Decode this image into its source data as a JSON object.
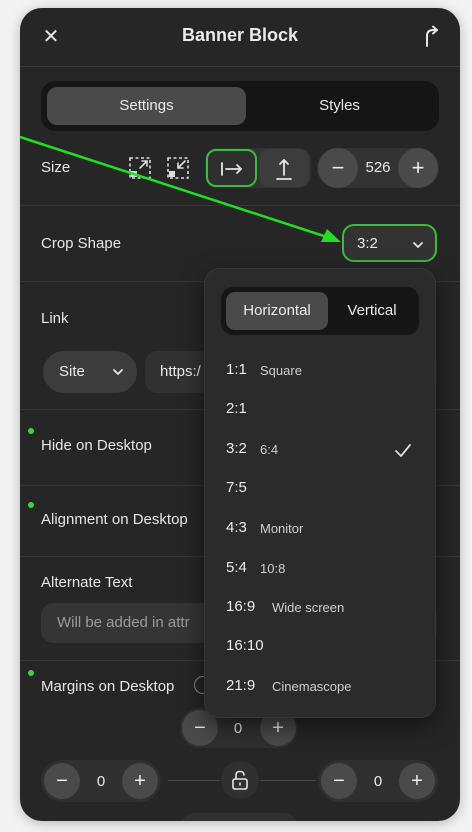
{
  "header": {
    "close_glyph": "✕",
    "title": "Banner Block"
  },
  "tabs": [
    {
      "label": "Settings",
      "active": true
    },
    {
      "label": "Styles",
      "active": false
    }
  ],
  "size": {
    "label": "Size",
    "minus": "−",
    "plus": "+",
    "value": "526"
  },
  "crop": {
    "label": "Crop Shape",
    "value": "3:2"
  },
  "link": {
    "label": "Link",
    "type_value": "Site",
    "url_value": "https:/"
  },
  "hide_desktop": {
    "label": "Hide on Desktop"
  },
  "alignment": {
    "label": "Alignment on Desktop"
  },
  "alt_text": {
    "label": "Alternate Text",
    "placeholder": "Will be added in attr"
  },
  "margins": {
    "label": "Margins on Desktop",
    "top_value": "0",
    "left_value": "0",
    "right_value": "0",
    "minus": "−",
    "plus": "+"
  },
  "dropdown": {
    "tabs": [
      {
        "label": "Horizontal",
        "active": true
      },
      {
        "label": "Vertical",
        "active": false
      }
    ],
    "items": [
      {
        "ratio": "1:1",
        "desc": "Square",
        "selected": false
      },
      {
        "ratio": "2:1",
        "desc": "",
        "selected": false
      },
      {
        "ratio": "3:2",
        "desc": "6:4",
        "selected": true
      },
      {
        "ratio": "7:5",
        "desc": "",
        "selected": false
      },
      {
        "ratio": "4:3",
        "desc": "Monitor",
        "selected": false
      },
      {
        "ratio": "5:4",
        "desc": "10:8",
        "selected": false
      },
      {
        "ratio": "16:9",
        "desc": "Wide screen",
        "selected": false
      },
      {
        "ratio": "16:10",
        "desc": "",
        "selected": false
      },
      {
        "ratio": "21:9",
        "desc": "Cinemascope",
        "selected": false
      }
    ]
  },
  "colors": {
    "panel_bg": "#262626",
    "accent_green": "#3dbb3d",
    "annotation_arrow": "#22dd22"
  },
  "icons": {
    "close": "close-icon",
    "export": "export-icon",
    "shrink_to_fit": "shrink-icon",
    "fit_inside": "fit-inside-icon",
    "fit_width": "fit-width-icon",
    "fit_height": "fit-height-icon",
    "chevron": "chevron-down-icon",
    "check": "check-icon",
    "lock": "unlock-icon"
  }
}
